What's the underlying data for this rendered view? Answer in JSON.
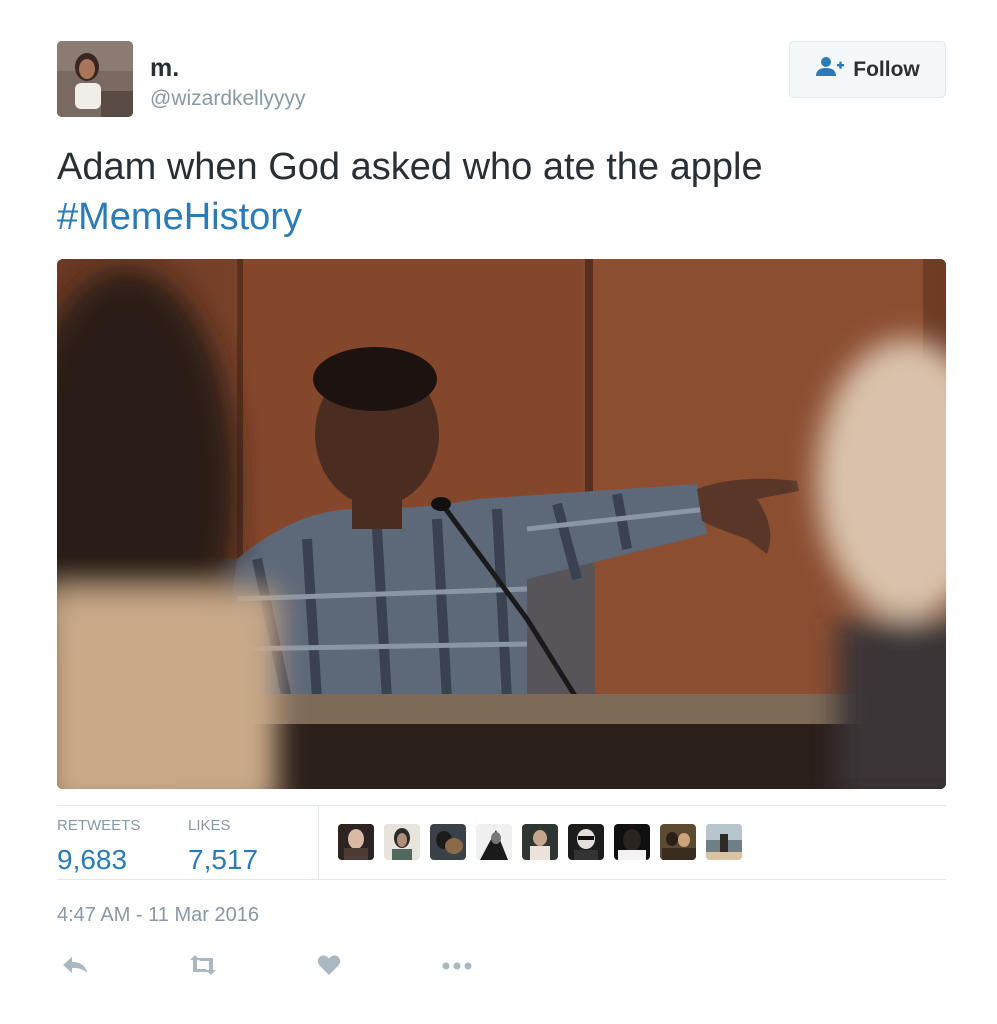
{
  "user": {
    "name": "m.",
    "handle": "@wizardkellyyyy"
  },
  "follow_button": {
    "label": "Follow",
    "icon": "person-add-icon"
  },
  "tweet": {
    "text": "Adam when God asked who ate the apple",
    "hashtag": "#MemeHistory"
  },
  "stats": {
    "retweets_label": "RETWEETS",
    "retweets_value": "9,683",
    "likes_label": "LIKES",
    "likes_value": "7,517"
  },
  "timestamp": "4:47 AM - 11 Mar 2016",
  "actions": [
    "reply-icon",
    "retweet-icon",
    "heart-icon",
    "more-icon"
  ],
  "colors": {
    "link": "#2b7bb9",
    "muted": "#8899a6",
    "text": "#292f33",
    "border": "#e1e8ed"
  }
}
